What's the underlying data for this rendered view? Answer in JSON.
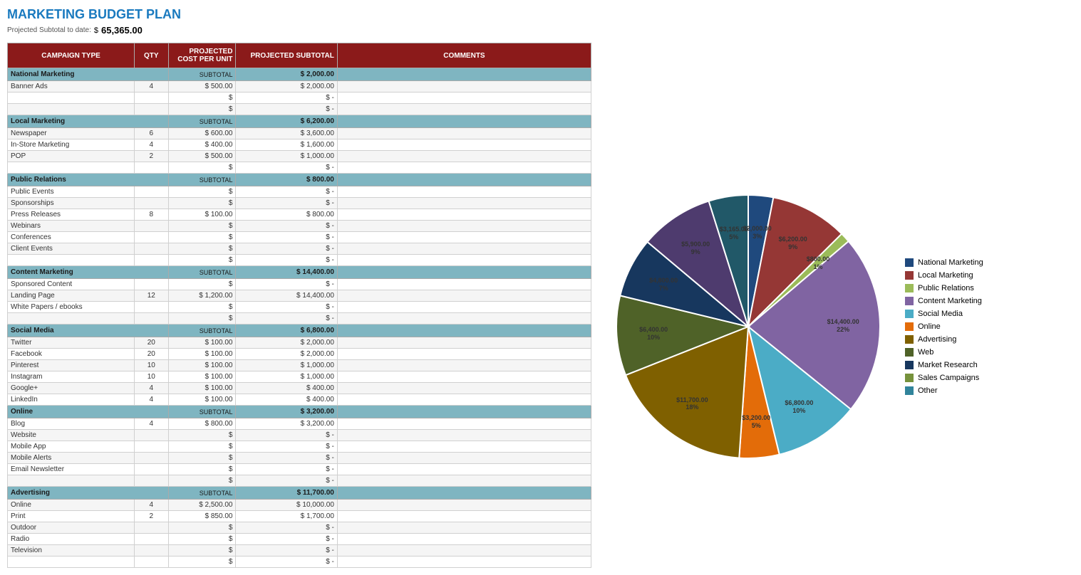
{
  "title": "MARKETING BUDGET PLAN",
  "subtitle_label": "Projected Subtotal to date:",
  "subtitle_dollar": "$",
  "subtitle_value": "65,365.00",
  "headers": [
    "CAMPAIGN TYPE",
    "QTY",
    "PROJECTED COST PER UNIT",
    "PROJECTED SUBTOTAL",
    "COMMENTS"
  ],
  "sections": [
    {
      "name": "National Marketing",
      "subtotal": "$ 2,000.00",
      "rows": [
        {
          "item": "Banner Ads",
          "qty": "4",
          "cost": "$ 500.00",
          "sub": "$ 2,000.00"
        },
        {
          "item": "",
          "qty": "",
          "cost": "$",
          "sub": "$  -"
        },
        {
          "item": "",
          "qty": "",
          "cost": "$",
          "sub": "$  -"
        }
      ]
    },
    {
      "name": "Local Marketing",
      "subtotal": "$ 6,200.00",
      "rows": [
        {
          "item": "Newspaper",
          "qty": "6",
          "cost": "$ 600.00",
          "sub": "$ 3,600.00"
        },
        {
          "item": "In-Store Marketing",
          "qty": "4",
          "cost": "$ 400.00",
          "sub": "$ 1,600.00"
        },
        {
          "item": "POP",
          "qty": "2",
          "cost": "$ 500.00",
          "sub": "$ 1,000.00"
        },
        {
          "item": "",
          "qty": "",
          "cost": "$",
          "sub": "$  -"
        }
      ]
    },
    {
      "name": "Public Relations",
      "subtotal": "$ 800.00",
      "rows": [
        {
          "item": "Public Events",
          "qty": "",
          "cost": "$",
          "sub": "$  -"
        },
        {
          "item": "Sponsorships",
          "qty": "",
          "cost": "$",
          "sub": "$  -"
        },
        {
          "item": "Press Releases",
          "qty": "8",
          "cost": "$ 100.00",
          "sub": "$ 800.00"
        },
        {
          "item": "Webinars",
          "qty": "",
          "cost": "$",
          "sub": "$  -"
        },
        {
          "item": "Conferences",
          "qty": "",
          "cost": "$",
          "sub": "$  -"
        },
        {
          "item": "Client Events",
          "qty": "",
          "cost": "$",
          "sub": "$  -"
        },
        {
          "item": "",
          "qty": "",
          "cost": "$",
          "sub": "$  -"
        }
      ]
    },
    {
      "name": "Content Marketing",
      "subtotal": "$ 14,400.00",
      "rows": [
        {
          "item": "Sponsored Content",
          "qty": "",
          "cost": "$",
          "sub": "$  -"
        },
        {
          "item": "Landing Page",
          "qty": "12",
          "cost": "$ 1,200.00",
          "sub": "$ 14,400.00"
        },
        {
          "item": "White Papers / ebooks",
          "qty": "",
          "cost": "$",
          "sub": "$  -"
        },
        {
          "item": "",
          "qty": "",
          "cost": "$",
          "sub": "$  -"
        }
      ]
    },
    {
      "name": "Social Media",
      "subtotal": "$ 6,800.00",
      "rows": [
        {
          "item": "Twitter",
          "qty": "20",
          "cost": "$ 100.00",
          "sub": "$ 2,000.00"
        },
        {
          "item": "Facebook",
          "qty": "20",
          "cost": "$ 100.00",
          "sub": "$ 2,000.00"
        },
        {
          "item": "Pinterest",
          "qty": "10",
          "cost": "$ 100.00",
          "sub": "$ 1,000.00"
        },
        {
          "item": "Instagram",
          "qty": "10",
          "cost": "$ 100.00",
          "sub": "$ 1,000.00"
        },
        {
          "item": "Google+",
          "qty": "4",
          "cost": "$ 100.00",
          "sub": "$ 400.00"
        },
        {
          "item": "LinkedIn",
          "qty": "4",
          "cost": "$ 100.00",
          "sub": "$ 400.00"
        }
      ]
    },
    {
      "name": "Online",
      "subtotal": "$ 3,200.00",
      "rows": [
        {
          "item": "Blog",
          "qty": "4",
          "cost": "$ 800.00",
          "sub": "$ 3,200.00"
        },
        {
          "item": "Website",
          "qty": "",
          "cost": "$",
          "sub": "$  -"
        },
        {
          "item": "Mobile App",
          "qty": "",
          "cost": "$",
          "sub": "$  -"
        },
        {
          "item": "Mobile Alerts",
          "qty": "",
          "cost": "$",
          "sub": "$  -"
        },
        {
          "item": "Email Newsletter",
          "qty": "",
          "cost": "$",
          "sub": "$  -"
        },
        {
          "item": "",
          "qty": "",
          "cost": "$",
          "sub": "$  -"
        }
      ]
    },
    {
      "name": "Advertising",
      "subtotal": "$ 11,700.00",
      "rows": [
        {
          "item": "Online",
          "qty": "4",
          "cost": "$ 2,500.00",
          "sub": "$ 10,000.00"
        },
        {
          "item": "Print",
          "qty": "2",
          "cost": "$ 850.00",
          "sub": "$ 1,700.00"
        },
        {
          "item": "Outdoor",
          "qty": "",
          "cost": "$",
          "sub": "$  -"
        },
        {
          "item": "Radio",
          "qty": "",
          "cost": "$",
          "sub": "$  -"
        },
        {
          "item": "Television",
          "qty": "",
          "cost": "$",
          "sub": "$  -"
        },
        {
          "item": "",
          "qty": "",
          "cost": "$",
          "sub": "$  -"
        }
      ]
    }
  ],
  "legend": [
    {
      "label": "National Marketing",
      "color": "#1f497d"
    },
    {
      "label": "Local Marketing",
      "color": "#953735"
    },
    {
      "label": "Public Relations",
      "color": "#9bbb59"
    },
    {
      "label": "Content Marketing",
      "color": "#8064a2"
    },
    {
      "label": "Social Media",
      "color": "#4bacc6"
    },
    {
      "label": "Online",
      "color": "#e36c09"
    },
    {
      "label": "Advertising",
      "color": "#7f6000"
    },
    {
      "label": "Web",
      "color": "#4f6228"
    },
    {
      "label": "Market Research",
      "color": "#17375e"
    },
    {
      "label": "Sales Campaigns",
      "color": "#76923c"
    },
    {
      "label": "Other",
      "color": "#31849b"
    }
  ],
  "pie_segments": [
    {
      "label": "National Marketing",
      "value": 2000,
      "percent": "3%",
      "amount": "$2,000.00",
      "color": "#1f497d",
      "startAngle": 0
    },
    {
      "label": "Local Marketing",
      "value": 6200,
      "percent": "9%",
      "amount": "$6,200.00",
      "color": "#953735",
      "startAngle": 11
    },
    {
      "label": "Public Relations",
      "value": 800,
      "percent": "1%",
      "amount": "$800.00",
      "color": "#9bbb59",
      "startAngle": 45
    },
    {
      "label": "Content Marketing",
      "value": 14400,
      "percent": "22%",
      "amount": "$14,400.00",
      "color": "#8064a2",
      "startAngle": 50
    },
    {
      "label": "Social Media",
      "value": 6800,
      "percent": "10%",
      "amount": "$6,800.00",
      "color": "#4bacc6",
      "startAngle": 130
    },
    {
      "label": "Online",
      "value": 3200,
      "percent": "5%",
      "amount": "$3,200.00",
      "color": "#e36c09",
      "startAngle": 167
    },
    {
      "label": "Advertising",
      "value": 11700,
      "percent": "18%",
      "amount": "$11,700.00",
      "color": "#7f6000",
      "startAngle": 185
    },
    {
      "label": "Web",
      "value": 6400,
      "percent": "10%",
      "amount": "$6,400.00",
      "color": "#4f6228",
      "startAngle": 249
    },
    {
      "label": "Market Research",
      "value": 4800,
      "percent": "7%",
      "amount": "$4,800.00",
      "color": "#17375e",
      "startAngle": 284
    },
    {
      "label": "Sales Campaigns",
      "value": 5900,
      "percent": "9%",
      "amount": "$5,900.00",
      "color": "#4e3b6e",
      "startAngle": 311
    },
    {
      "label": "Other",
      "value": 3165,
      "percent": "5%",
      "amount": "$3,165.00",
      "color": "#215868",
      "startAngle": 344
    }
  ]
}
